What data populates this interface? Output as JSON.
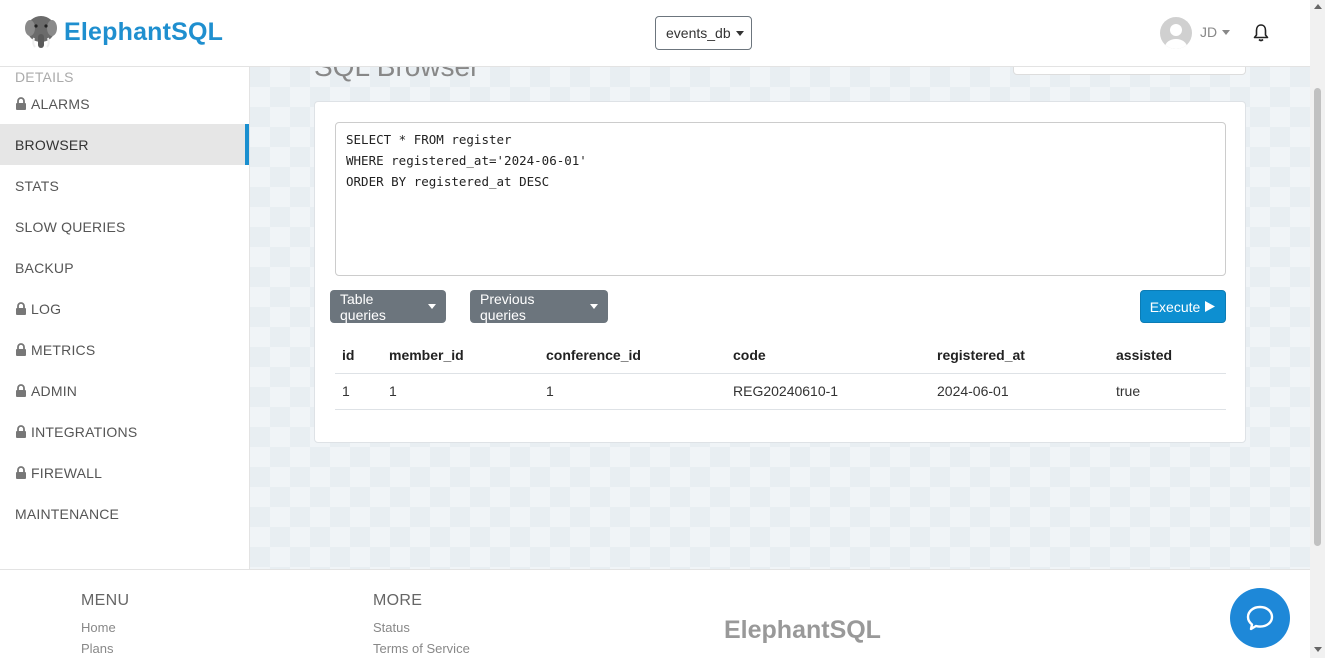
{
  "header": {
    "brand": "ElephantSQL",
    "database": "events_db",
    "user_initials": "JD"
  },
  "sidebar": {
    "partial_item": "DETAILS",
    "items": [
      {
        "label": "ALARMS",
        "locked": true
      },
      {
        "label": "BROWSER",
        "locked": false,
        "active": true
      },
      {
        "label": "STATS",
        "locked": false
      },
      {
        "label": "SLOW QUERIES",
        "locked": false
      },
      {
        "label": "BACKUP",
        "locked": false
      },
      {
        "label": "LOG",
        "locked": true
      },
      {
        "label": "METRICS",
        "locked": true
      },
      {
        "label": "ADMIN",
        "locked": true
      },
      {
        "label": "INTEGRATIONS",
        "locked": true
      },
      {
        "label": "FIREWALL",
        "locked": true
      },
      {
        "label": "MAINTENANCE",
        "locked": false
      }
    ]
  },
  "main": {
    "title": "SQL Browser",
    "query": "SELECT * FROM register\nWHERE registered_at='2024-06-01'\nORDER BY registered_at DESC",
    "table_queries_label": "Table queries",
    "previous_queries_label": "Previous queries",
    "execute_label": "Execute"
  },
  "results": {
    "columns": [
      "id",
      "member_id",
      "conference_id",
      "code",
      "registered_at",
      "assisted"
    ],
    "rows": [
      [
        "1",
        "1",
        "1",
        "REG20240610-1",
        "2024-06-01",
        "true"
      ]
    ]
  },
  "footer": {
    "menu_heading": "MENU",
    "menu_links": [
      "Home",
      "Plans"
    ],
    "more_heading": "MORE",
    "more_links": [
      "Status",
      "Terms of Service"
    ],
    "brand": "ElephantSQL"
  },
  "colors": {
    "brand_blue": "#1f8fcf",
    "execute_blue": "#0d8fd1",
    "gray_button": "#6c757d",
    "active_indicator": "#1a8fcf",
    "chat_blue": "#1e88d8"
  }
}
